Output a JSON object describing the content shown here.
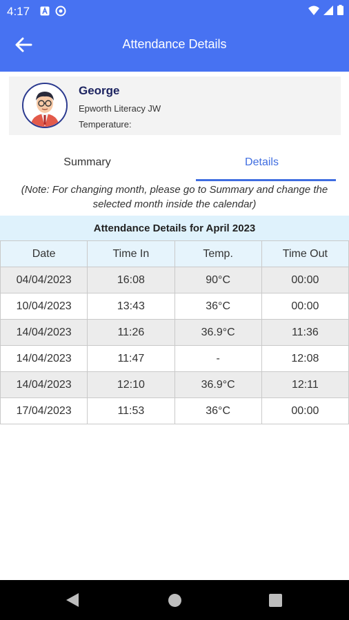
{
  "status_bar": {
    "time": "4:17",
    "left_icons": [
      "a-icon",
      "sync-icon"
    ],
    "right_icons": [
      "wifi-icon",
      "signal-icon",
      "battery-icon"
    ]
  },
  "app_bar": {
    "title": "Attendance Details",
    "back_icon": "arrow-left-icon"
  },
  "profile": {
    "name": "George",
    "school": "Epworth Literacy JW",
    "temperature_label": "Temperature:"
  },
  "tabs": [
    {
      "label": "Summary",
      "selected": false
    },
    {
      "label": "Details",
      "selected": true
    }
  ],
  "note": "(Note: For changing month, please go to Summary and change the selected month inside the calendar)",
  "table": {
    "title": "Attendance Details for April 2023",
    "headers": [
      "Date",
      "Time In",
      "Temp.",
      "Time Out"
    ],
    "rows": [
      [
        "04/04/2023",
        "16:08",
        "90°C",
        "00:00"
      ],
      [
        "10/04/2023",
        "13:43",
        "36°C",
        "00:00"
      ],
      [
        "14/04/2023",
        "11:26",
        "36.9°C",
        "11:36"
      ],
      [
        "14/04/2023",
        "11:47",
        "-",
        "12:08"
      ],
      [
        "14/04/2023",
        "12:10",
        "36.9°C",
        "12:11"
      ],
      [
        "17/04/2023",
        "11:53",
        "36°C",
        "00:00"
      ]
    ]
  },
  "colors": {
    "primary": "#4772f2",
    "tab_active": "#3f6de0",
    "table_header_bg": "#dff2fc"
  },
  "nav_bar": {
    "buttons": [
      "back-triangle-icon",
      "home-circle-icon",
      "recents-square-icon"
    ]
  }
}
